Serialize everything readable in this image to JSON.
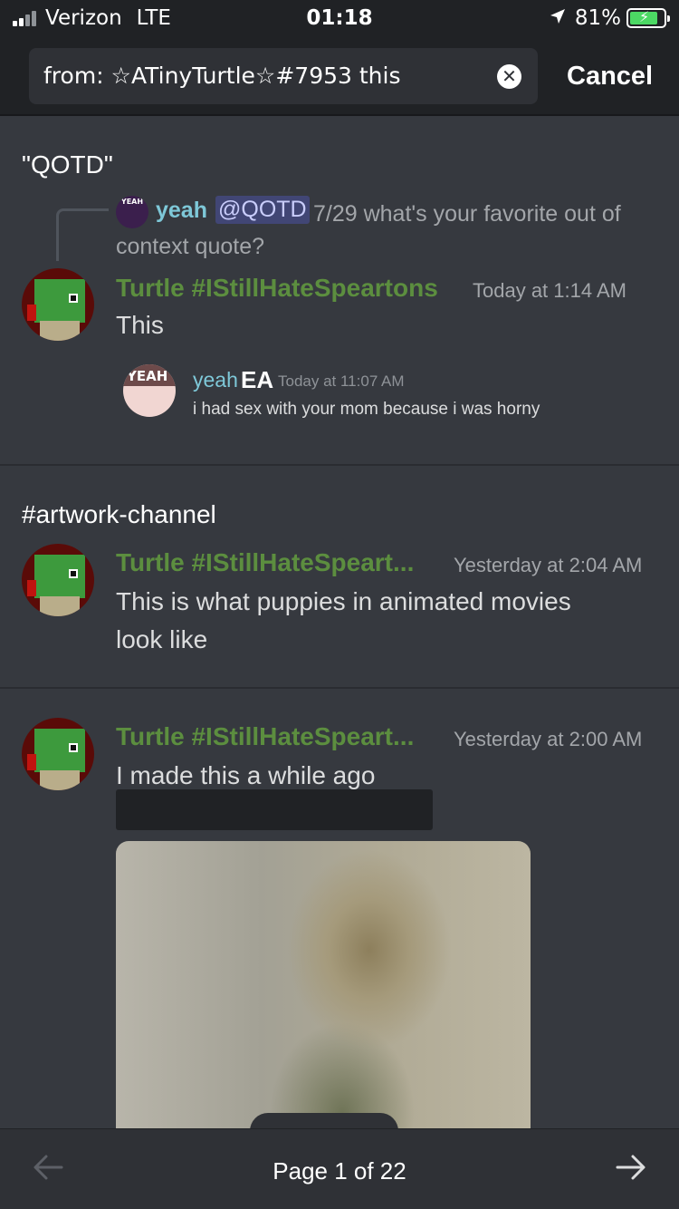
{
  "status_bar": {
    "carrier": "Verizon",
    "network": "LTE",
    "time": "01:18",
    "battery_percent": "81%",
    "battery_level": 0.81
  },
  "search": {
    "query": "from: ☆ATinyTurtle☆#7953 this",
    "cancel_label": "Cancel"
  },
  "results": [
    {
      "channel": "\"QOTD\"",
      "reply": {
        "avatar_text": "YEAH",
        "author": "yeah",
        "mention": "@QOTD",
        "text": "7/29 what's your favorite out of context quote?"
      },
      "author": "Turtle #IStillHateSpeartons",
      "timestamp": "Today at 1:14 AM",
      "content": "This",
      "embed": {
        "avatar_text": "YEAH",
        "author": "yeah",
        "tag": "EA",
        "timestamp": "Today at 11:07 AM",
        "text": "i had sex with your mom because i was horny"
      }
    },
    {
      "channel": "#artwork-channel",
      "author": "Turtle #IStillHateSpeart...",
      "timestamp": "Yesterday at 2:04 AM",
      "content_line1": "This is what puppies in animated movies",
      "content_line2": "look like"
    },
    {
      "author": "Turtle #IStillHateSpeart...",
      "timestamp": "Yesterday at 2:00 AM",
      "content": "I made this a while ago"
    }
  ],
  "pager": {
    "label": "Page 1 of 22",
    "prev_icon": "arrow-left-icon",
    "next_icon": "arrow-right-icon"
  },
  "colors": {
    "author_green": "#5c8e3f",
    "background": "#36393f",
    "header": "#202225",
    "mention_bg": "#414675"
  }
}
